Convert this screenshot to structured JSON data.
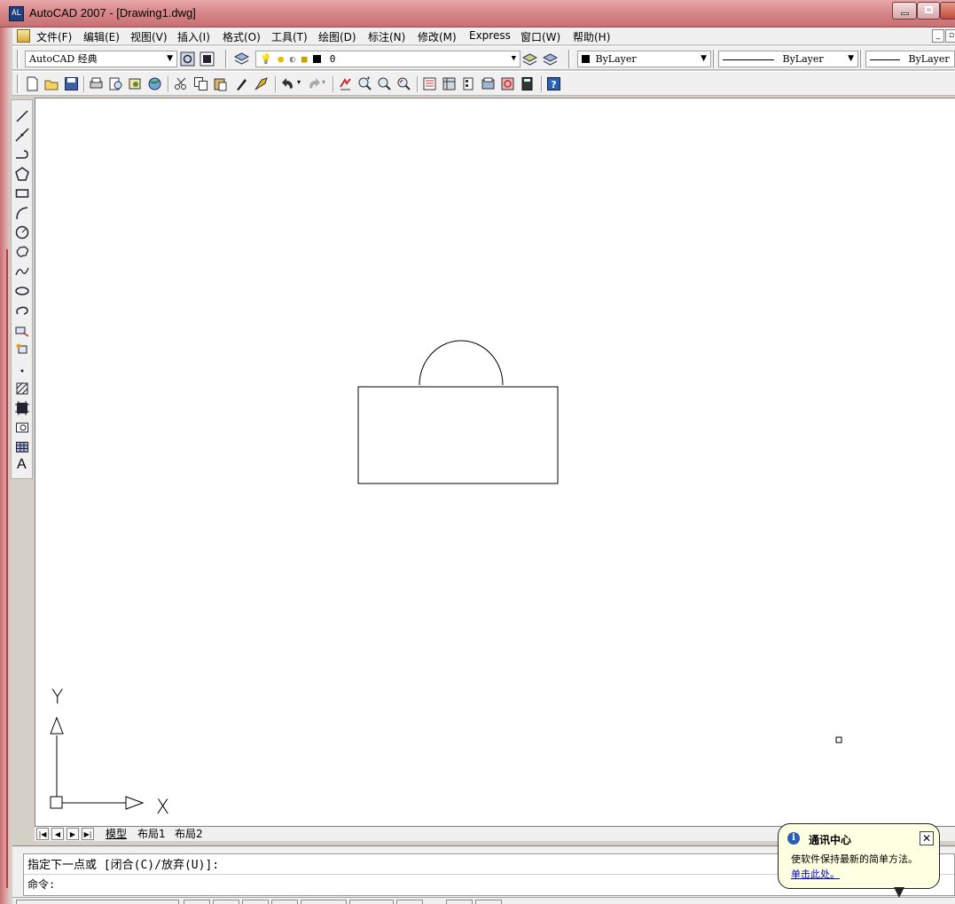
{
  "window": {
    "title": "AutoCAD 2007 - [Drawing1.dwg]",
    "app_icon_text": "AL"
  },
  "menu": {
    "items": [
      "文件(F)",
      "编辑(E)",
      "视图(V)",
      "插入(I)",
      "格式(O)",
      "工具(T)",
      "绘图(D)",
      "标注(N)",
      "修改(M)",
      "Express",
      "窗口(W)",
      "帮助(H)"
    ]
  },
  "toolbar1": {
    "workspace": "AutoCAD 经典",
    "layer": "0",
    "color": "ByLayer",
    "linetype": "ByLayer",
    "lineweight": "ByLayer"
  },
  "left_toolbar": {
    "text_tool_label": "A"
  },
  "canvas": {
    "ucs_y_label": "Y",
    "ucs_x_label": "X"
  },
  "layout_tabs": {
    "tabs": [
      "模型",
      "布局1",
      "布局2"
    ],
    "active": "模型"
  },
  "command": {
    "history_line": "指定下一点或 [闭合(C)/放弃(U)]:",
    "prompt": "命令:"
  },
  "notification": {
    "title": "通讯中心",
    "message": "使软件保持最新的简单方法。",
    "link": "单击此处。"
  },
  "icons": [
    "new-icon",
    "open-icon",
    "save-icon",
    "print-icon",
    "preview-icon",
    "publish-icon",
    "cut-icon",
    "copy-icon",
    "paste-icon",
    "matchprop-icon",
    "undo-icon",
    "redo-icon",
    "pan-icon",
    "zoom-icon",
    "properties-icon",
    "calculator-icon",
    "help-icon"
  ]
}
